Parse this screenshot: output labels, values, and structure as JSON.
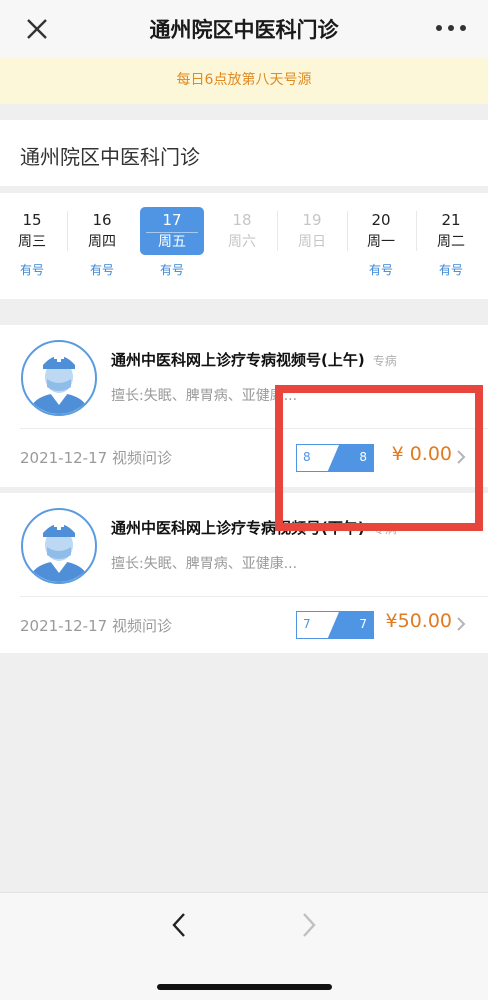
{
  "header": {
    "title": "通州院区中医科门诊",
    "close_icon": "close-icon",
    "more_icon": "more-icon"
  },
  "notice": "每日6点放第八天号源",
  "department": "通州院区中医科门诊",
  "dates": [
    {
      "day": "15",
      "weekday": "周三",
      "avail": "有号"
    },
    {
      "day": "16",
      "weekday": "周四",
      "avail": "有号"
    },
    {
      "day": "17",
      "weekday": "周五",
      "avail": "有号"
    },
    {
      "day": "18",
      "weekday": "周六",
      "avail": ""
    },
    {
      "day": "19",
      "weekday": "周日",
      "avail": ""
    },
    {
      "day": "20",
      "weekday": "周一",
      "avail": "有号"
    },
    {
      "day": "21",
      "weekday": "周二",
      "avail": "有号"
    }
  ],
  "selected_date": "17",
  "slots": [
    {
      "name": "通州中医科网上诊疗专病视频号(上午)",
      "tag": "专病",
      "specialty": "擅长:失眠、脾胃病、亚健康...",
      "date_type": "2021-12-17 视频问诊",
      "quota_left": "8",
      "quota_right": "8",
      "price": "¥  0.00"
    },
    {
      "name": "通州中医科网上诊疗专病视频号(下午)",
      "tag": "专病",
      "specialty": "擅长:失眠、脾胃病、亚健康...",
      "date_type": "2021-12-17 视频问诊",
      "quota_left": "7",
      "quota_right": "7",
      "price": "¥50.00"
    }
  ],
  "colors": {
    "accent": "#4f95e3",
    "price": "#e07b22",
    "notice_text": "#e08a22",
    "highlight": "#e8453c"
  }
}
